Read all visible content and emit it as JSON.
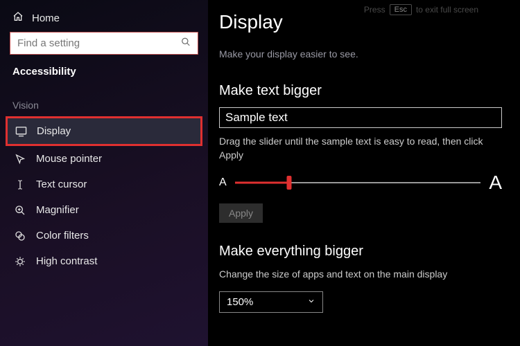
{
  "fullscreen_hint": {
    "pre": "Press",
    "key": "Esc",
    "post": "to exit full screen"
  },
  "sidebar": {
    "home": "Home",
    "search_placeholder": "Find a setting",
    "title": "Accessibility",
    "group": "Vision",
    "items": [
      {
        "label": "Display"
      },
      {
        "label": "Mouse pointer"
      },
      {
        "label": "Text cursor"
      },
      {
        "label": "Magnifier"
      },
      {
        "label": "Color filters"
      },
      {
        "label": "High contrast"
      }
    ]
  },
  "page": {
    "title": "Display",
    "subtitle": "Make your display easier to see.",
    "text_section": {
      "heading": "Make text bigger",
      "sample": "Sample text",
      "instruction": "Drag the slider until the sample text is easy to read, then click Apply",
      "small_a": "A",
      "large_a": "A",
      "slider_percent": 22,
      "apply": "Apply"
    },
    "everything_section": {
      "heading": "Make everything bigger",
      "instruction": "Change the size of apps and text on the main display",
      "value": "150%"
    }
  }
}
